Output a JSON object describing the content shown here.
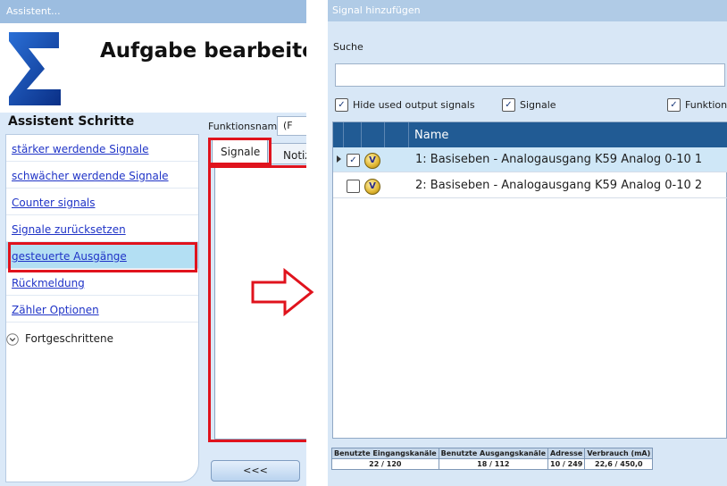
{
  "left_window": {
    "title": "Assistent...",
    "heading": "Aufgabe bearbeiten",
    "steps_title": "Assistent Schritte",
    "steps": [
      {
        "label": "stärker werdende Signale"
      },
      {
        "label": "schwächer werdende Signale"
      },
      {
        "label": "Counter signals"
      },
      {
        "label": "Signale zurücksetzen"
      },
      {
        "label": "gesteuerte Ausgänge",
        "selected": true
      },
      {
        "label": "Rückmeldung"
      },
      {
        "label": "Zähler Optionen"
      }
    ],
    "advanced_label": "Fortgeschrittene",
    "function_name_label": "Funktionsname",
    "function_name_value": "(F",
    "tabs": [
      {
        "label": "Signale",
        "active": true
      },
      {
        "label": "Notiz"
      }
    ],
    "back_button": "<<<"
  },
  "right_window": {
    "title": "Signal hinzufügen",
    "search_label": "Suche",
    "search_value": "",
    "filters": [
      {
        "label": "Hide used output signals",
        "checked": true
      },
      {
        "label": "Signale",
        "checked": true
      },
      {
        "label": "Funktione",
        "checked": true
      }
    ],
    "grid": {
      "column_name": "Name",
      "rows": [
        {
          "name": "1: Basiseben - Analogausgang K59 Analog 0-10 1",
          "checked": true,
          "icon": "V",
          "selected": true
        },
        {
          "name": "2: Basiseben - Analogausgang K59 Analog 0-10 2",
          "checked": false,
          "icon": "V",
          "selected": false
        }
      ]
    },
    "stats": {
      "headers": [
        "Benutzte Eingangskanäle",
        "Benutzte Ausgangskanäle",
        "Adresse",
        "Verbrauch (mA)"
      ],
      "values": [
        "22 / 120",
        "18 / 112",
        "10 / 249",
        "22,6 / 450,0"
      ]
    }
  },
  "colors": {
    "highlight_red": "#e0131d",
    "grid_header": "#215b94",
    "selected_row": "#cfe7f7"
  }
}
